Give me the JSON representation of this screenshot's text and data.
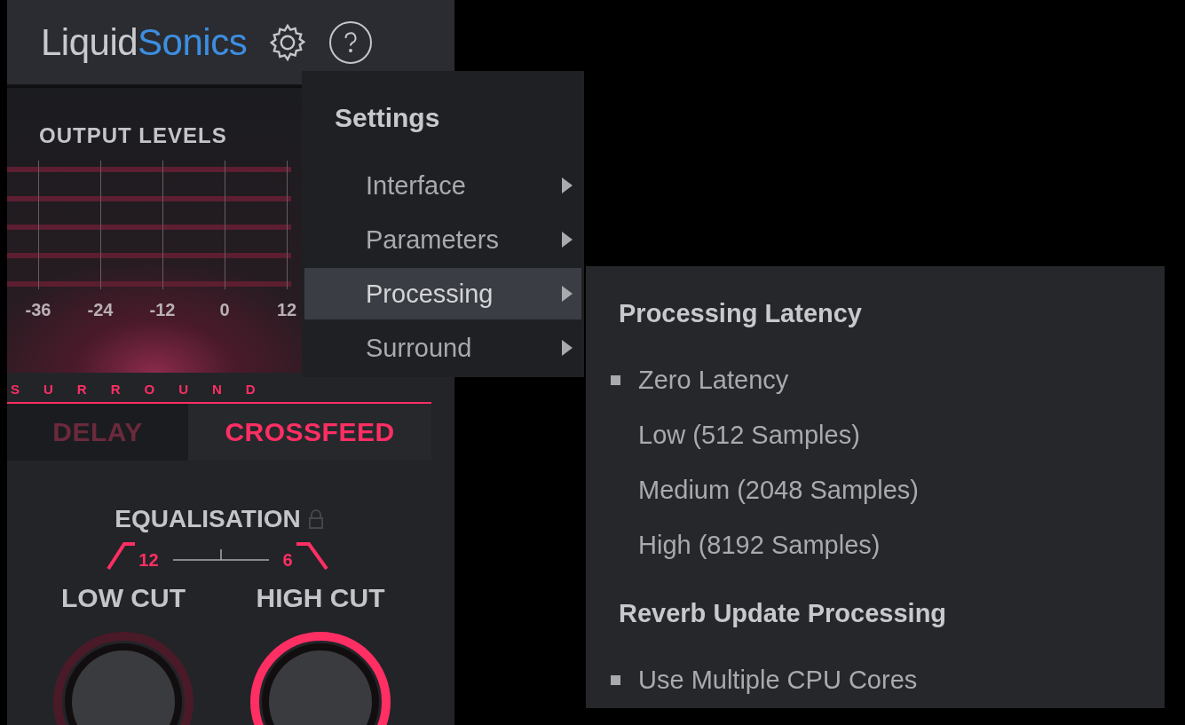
{
  "logo": {
    "part_1": "Liquid",
    "part_2": "Sonics"
  },
  "meter": {
    "title": "OUTPUT LEVELS",
    "ticks": [
      "-36",
      "-24",
      "-12",
      "0",
      "12"
    ]
  },
  "section_label": "SURROUND",
  "tabs": [
    {
      "label": "DELAY",
      "selected": false
    },
    {
      "label": "CROSSFEED",
      "selected": true
    }
  ],
  "equalisation": {
    "title": "EQUALISATION",
    "low_slope": "12",
    "high_slope": "6",
    "knobs": [
      {
        "label": "LOW CUT",
        "active": false
      },
      {
        "label": "HIGH CUT",
        "active": true
      }
    ]
  },
  "settings_menu": {
    "title": "Settings",
    "items": [
      {
        "label": "Interface",
        "selected": false
      },
      {
        "label": "Parameters",
        "selected": false
      },
      {
        "label": "Processing",
        "selected": true
      },
      {
        "label": "Surround",
        "selected": false
      }
    ]
  },
  "processing_submenu": {
    "sections": [
      {
        "heading": "Processing Latency",
        "options": [
          {
            "label": "Zero Latency",
            "checked": true
          },
          {
            "label": "Low (512 Samples)",
            "checked": false
          },
          {
            "label": "Medium (2048 Samples)",
            "checked": false
          },
          {
            "label": "High (8192 Samples)",
            "checked": false
          }
        ]
      },
      {
        "heading": "Reverb Update Processing",
        "options": [
          {
            "label": "Use Multiple CPU Cores",
            "checked": true
          }
        ]
      }
    ]
  }
}
